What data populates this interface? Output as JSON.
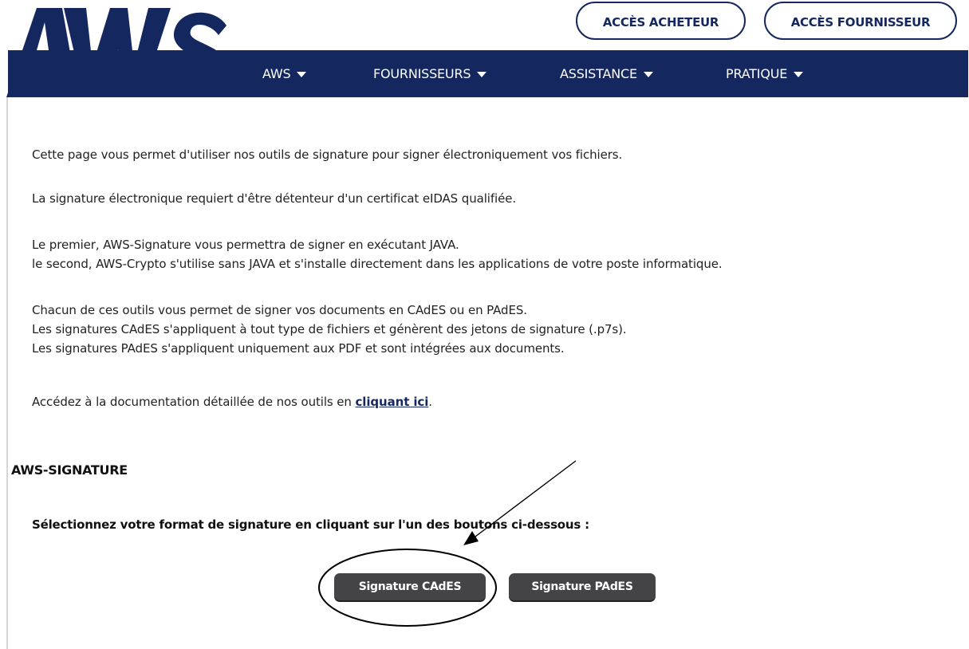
{
  "header": {
    "logo_text": "AWS",
    "access_buttons": [
      {
        "label": "ACCÈS ACHETEUR"
      },
      {
        "label": "ACCÈS FOURNISSEUR"
      }
    ],
    "nav": [
      {
        "label": "AWS"
      },
      {
        "label": "FOURNISSEURS"
      },
      {
        "label": "ASSISTANCE"
      },
      {
        "label": "PRATIQUE"
      }
    ]
  },
  "content": {
    "paragraphs": [
      [
        "Cette page vous permet d'utiliser nos outils de signature pour signer électroniquement vos fichiers."
      ],
      [
        "La signature électronique requiert d'être détenteur d'un certificat eIDAS qualifiée."
      ],
      [
        "Le premier, AWS-Signature vous permettra de signer en exécutant JAVA.",
        "le second, AWS-Crypto s'utilise sans JAVA et s'installe directement dans les applications de votre poste informatique."
      ],
      [
        "Chacun de ces outils vous permet de signer vos documents en CAdES ou en PAdES.",
        "Les signatures CAdES s'appliquent à tout type de fichiers et génèrent des jetons de signature (.p7s).",
        "Les signatures PAdES s'appliquent uniquement aux PDF et sont intégrées aux documents."
      ]
    ],
    "doc_prefix": "Accédez à la documentation détaillée de nos outils en ",
    "doc_link": "cliquant ici",
    "doc_suffix": ".",
    "section_title": "AWS-SIGNATURE",
    "instruction": "Sélectionnez votre format de signature en cliquant sur l'un des boutons ci-dessous :",
    "buttons": {
      "cades": "Signature CAdES",
      "pades": "Signature PAdES"
    }
  },
  "colors": {
    "navy": "#15275f",
    "button": "#444446"
  }
}
